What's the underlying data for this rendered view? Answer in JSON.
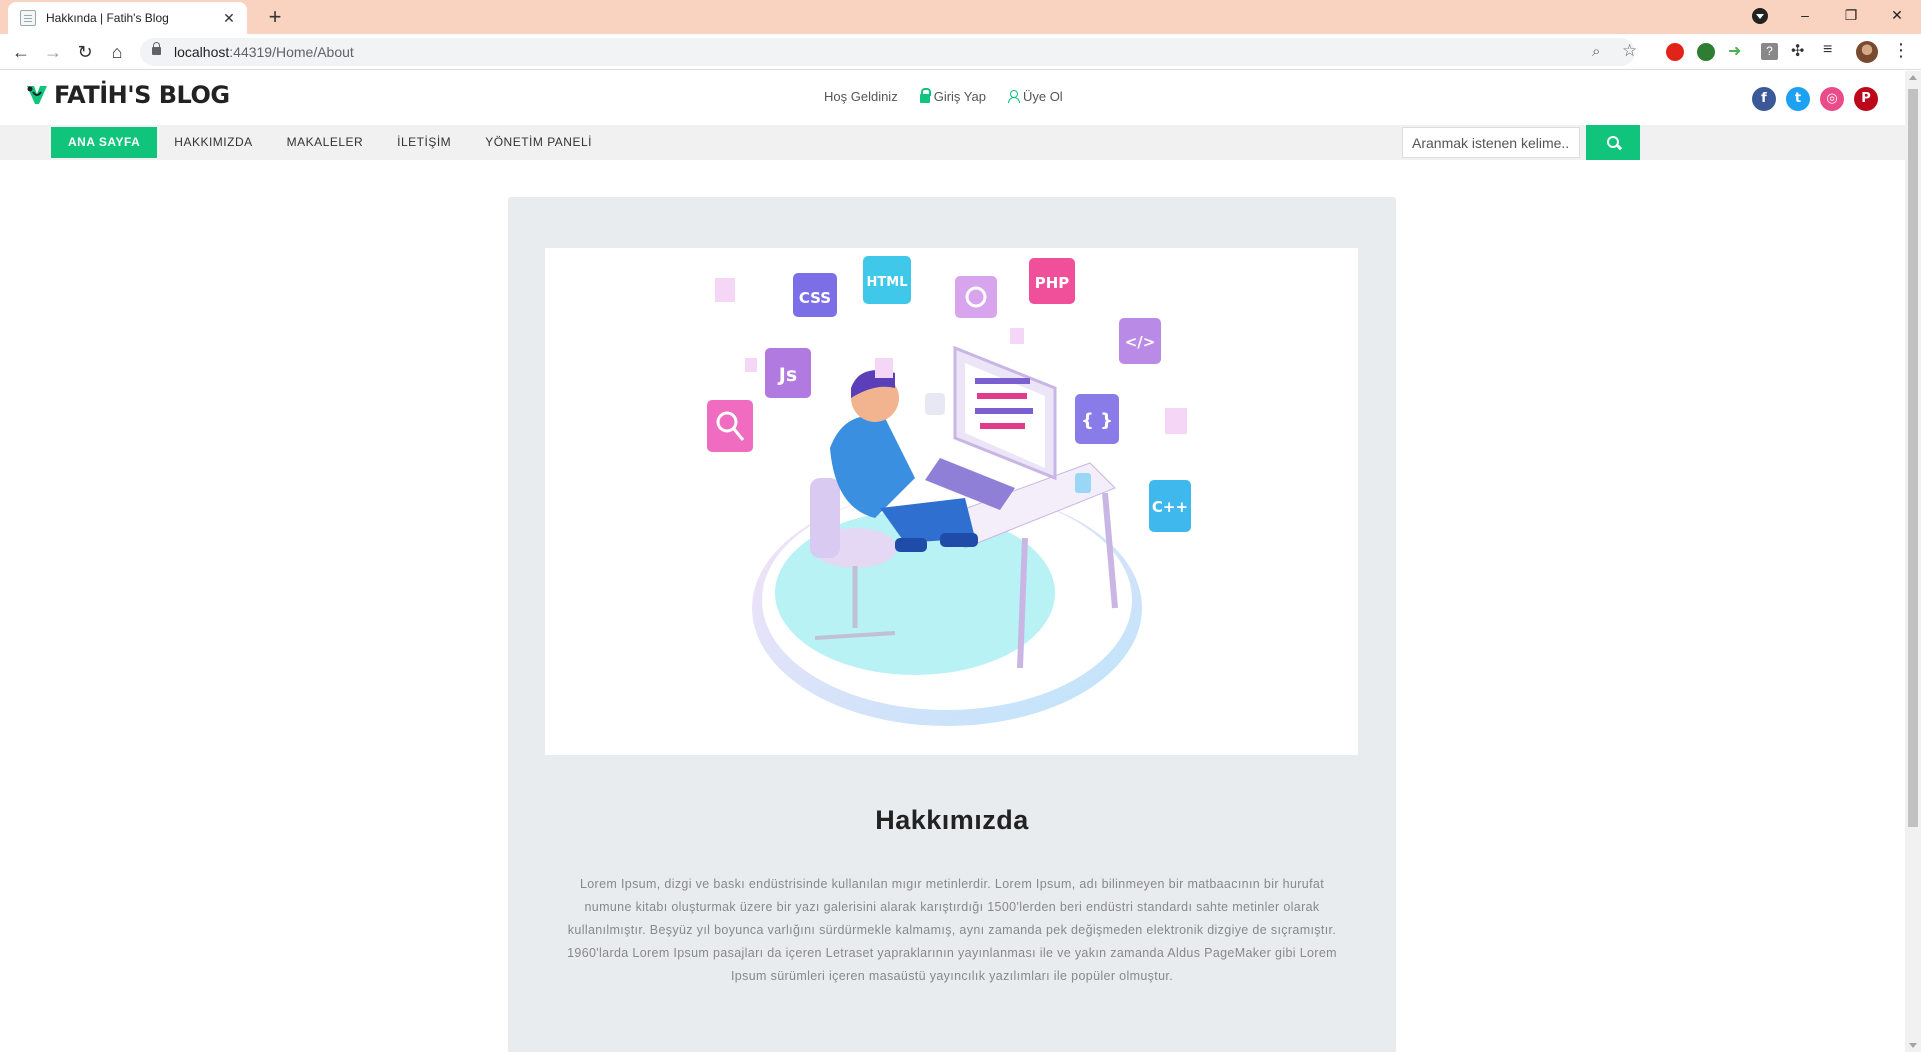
{
  "browser": {
    "tab_title": "Hakkında | Fatih's Blog",
    "tab_close": "✕",
    "new_tab": "+",
    "url_host": "localhost",
    "url_path": ":44319/Home/About",
    "window_controls": [
      "–",
      "❐",
      "✕"
    ]
  },
  "header": {
    "logo_text": "FATİH'S BLOG",
    "links": {
      "welcome": "Hoş Geldiniz",
      "login": "Giriş Yap",
      "register": "Üye Ol"
    },
    "socials": [
      {
        "name": "facebook-icon",
        "glyph": "f",
        "color": "#3b5998"
      },
      {
        "name": "twitter-icon",
        "glyph": "t",
        "color": "#1da1f2"
      },
      {
        "name": "dribbble-icon",
        "glyph": "◎",
        "color": "#ea4c89"
      },
      {
        "name": "pinterest-icon",
        "glyph": "P",
        "color": "#bd081c"
      }
    ]
  },
  "nav": {
    "items": [
      "ANA SAYFA",
      "HAKKIMIZDA",
      "MAKALELER",
      "İLETİŞİM",
      "YÖNETİM PANELİ"
    ],
    "active_index": 0,
    "search_placeholder": "Aranmak istenen kelime..."
  },
  "content": {
    "hero_labels": [
      "CSS",
      "HTML",
      "PHP",
      "Js",
      "{ }",
      "</>",
      "C++"
    ],
    "title": "Hakkımızda",
    "body": "Lorem Ipsum, dizgi ve baskı endüstrisinde kullanılan mıgır metinlerdir. Lorem Ipsum, adı bilinmeyen bir matbaacının bir hurufat numune kitabı oluşturmak üzere bir yazı galerisini alarak karıştırdığı 1500'lerden beri endüstri standardı sahte metinler olarak kullanılmıştır. Beşyüz yıl boyunca varlığını sürdürmekle kalmamış, aynı zamanda pek değişmeden elektronik dizgiye de sıçramıştır. 1960'larda Lorem Ipsum pasajları da içeren Letraset yapraklarının yayınlanması ile ve yakın zamanda Aldus PageMaker gibi Lorem Ipsum sürümleri içeren masaüstü yayıncılık yazılımları ile popüler olmuştur."
  },
  "colors": {
    "accent": "#10c57b",
    "card_bg": "#e9ecef",
    "titlebar": "#f9d3c0"
  }
}
